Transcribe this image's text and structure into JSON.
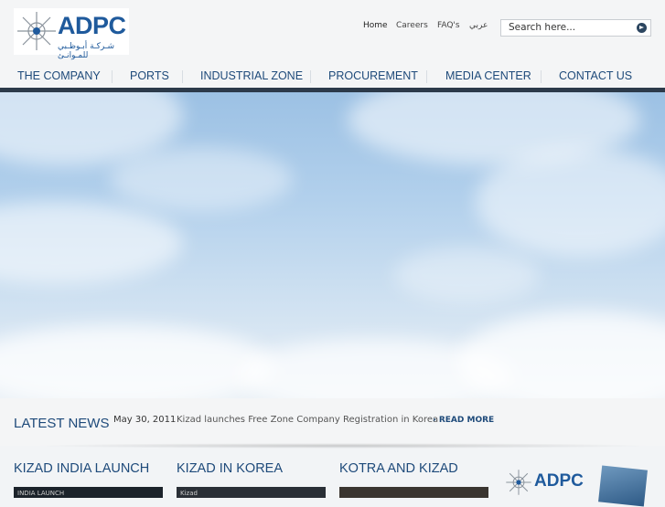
{
  "header": {
    "logo_text": "ADPC",
    "logo_subtitle": "شـركـة أبـوظـبي للمـوانـئ",
    "top_links": [
      {
        "label": "Home"
      },
      {
        "label": "Careers"
      },
      {
        "label": "FAQ's"
      },
      {
        "label": "عربي"
      }
    ],
    "search": {
      "placeholder": "Search here..."
    }
  },
  "nav": {
    "items": [
      {
        "label": "THE COMPANY"
      },
      {
        "label": "PORTS"
      },
      {
        "label": "INDUSTRIAL ZONE"
      },
      {
        "label": "PROCUREMENT"
      },
      {
        "label": "MEDIA CENTER"
      },
      {
        "label": "CONTACT US"
      }
    ]
  },
  "news": {
    "title": "LATEST NEWS",
    "date": "May 30, 2011",
    "text": "Kizad launches Free Zone Company Registration in Korea",
    "read_more": "READ MORE"
  },
  "cards": [
    {
      "title": "KIZAD INDIA LAUNCH",
      "thumb_label": "INDIA LAUNCH"
    },
    {
      "title": "KIZAD IN KOREA",
      "thumb_label": "Kizad"
    },
    {
      "title": "KOTRA AND KIZAD",
      "thumb_label": ""
    }
  ],
  "promo": {
    "logo_text": "ADPC"
  },
  "colors": {
    "brand": "#1e4a7a",
    "nav_bar": "#2c3a4a",
    "logo_blue": "#1f5a9c"
  }
}
